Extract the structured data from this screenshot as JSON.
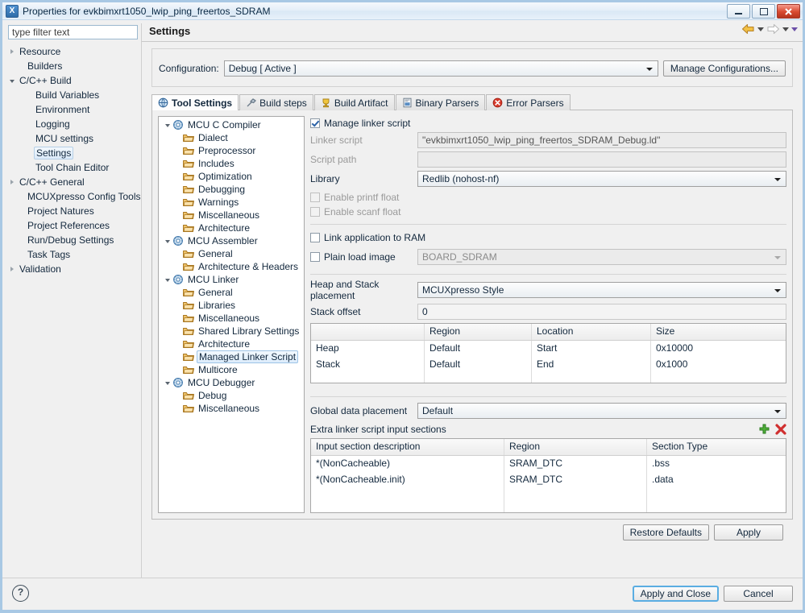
{
  "window": {
    "title": "Properties for evkbimxrt1050_lwip_ping_freertos_SDRAM",
    "app_icon": "X",
    "minimize_label": "Minimize",
    "maximize_label": "Maximize",
    "close_label": "Close"
  },
  "filter": {
    "placeholder": "type filter text",
    "value": ""
  },
  "sidebar": {
    "items": [
      {
        "label": "Resource",
        "indent": 0,
        "twisty": "collapsed",
        "selected": false
      },
      {
        "label": "Builders",
        "indent": 1,
        "twisty": "none",
        "selected": false
      },
      {
        "label": "C/C++ Build",
        "indent": 0,
        "twisty": "expanded",
        "selected": false
      },
      {
        "label": "Build Variables",
        "indent": 2,
        "twisty": "none",
        "selected": false
      },
      {
        "label": "Environment",
        "indent": 2,
        "twisty": "none",
        "selected": false
      },
      {
        "label": "Logging",
        "indent": 2,
        "twisty": "none",
        "selected": false
      },
      {
        "label": "MCU settings",
        "indent": 2,
        "twisty": "none",
        "selected": false
      },
      {
        "label": "Settings",
        "indent": 2,
        "twisty": "none",
        "selected": true
      },
      {
        "label": "Tool Chain Editor",
        "indent": 2,
        "twisty": "none",
        "selected": false
      },
      {
        "label": "C/C++ General",
        "indent": 0,
        "twisty": "collapsed",
        "selected": false
      },
      {
        "label": "MCUXpresso Config Tools",
        "indent": 1,
        "twisty": "none",
        "selected": false
      },
      {
        "label": "Project Natures",
        "indent": 1,
        "twisty": "none",
        "selected": false
      },
      {
        "label": "Project References",
        "indent": 1,
        "twisty": "none",
        "selected": false
      },
      {
        "label": "Run/Debug Settings",
        "indent": 1,
        "twisty": "none",
        "selected": false
      },
      {
        "label": "Task Tags",
        "indent": 1,
        "twisty": "none",
        "selected": false
      },
      {
        "label": "Validation",
        "indent": 0,
        "twisty": "collapsed",
        "selected": false
      }
    ]
  },
  "page": {
    "title": "Settings",
    "nav": {
      "back_icon": "back-arrow-icon",
      "back_menu_icon": "chevron-down-icon",
      "forward_icon": "forward-arrow-icon",
      "forward_menu_icon": "chevron-down-icon",
      "view_menu_icon": "chevron-down-icon"
    }
  },
  "configuration": {
    "label": "Configuration:",
    "value": "Debug  [ Active ]",
    "manage_label": "Manage Configurations..."
  },
  "tabs": [
    {
      "label": "Tool Settings",
      "icon": "tool-settings-icon",
      "active": true
    },
    {
      "label": "Build steps",
      "icon": "build-steps-icon",
      "active": false
    },
    {
      "label": "Build Artifact",
      "icon": "build-artifact-icon",
      "active": false
    },
    {
      "label": "Binary Parsers",
      "icon": "binary-parsers-icon",
      "active": false
    },
    {
      "label": "Error Parsers",
      "icon": "error-parsers-icon",
      "active": false
    }
  ],
  "tool_tree": [
    {
      "label": "MCU C Compiler",
      "indent": 0,
      "twisty": "expanded",
      "icon": "gear",
      "selected": false
    },
    {
      "label": "Dialect",
      "indent": 1,
      "twisty": "none",
      "icon": "folder",
      "selected": false
    },
    {
      "label": "Preprocessor",
      "indent": 1,
      "twisty": "none",
      "icon": "folder",
      "selected": false
    },
    {
      "label": "Includes",
      "indent": 1,
      "twisty": "none",
      "icon": "folder",
      "selected": false
    },
    {
      "label": "Optimization",
      "indent": 1,
      "twisty": "none",
      "icon": "folder",
      "selected": false
    },
    {
      "label": "Debugging",
      "indent": 1,
      "twisty": "none",
      "icon": "folder",
      "selected": false
    },
    {
      "label": "Warnings",
      "indent": 1,
      "twisty": "none",
      "icon": "folder",
      "selected": false
    },
    {
      "label": "Miscellaneous",
      "indent": 1,
      "twisty": "none",
      "icon": "folder",
      "selected": false
    },
    {
      "label": "Architecture",
      "indent": 1,
      "twisty": "none",
      "icon": "folder",
      "selected": false
    },
    {
      "label": "MCU Assembler",
      "indent": 0,
      "twisty": "expanded",
      "icon": "gear",
      "selected": false
    },
    {
      "label": "General",
      "indent": 1,
      "twisty": "none",
      "icon": "folder",
      "selected": false
    },
    {
      "label": "Architecture & Headers",
      "indent": 1,
      "twisty": "none",
      "icon": "folder",
      "selected": false
    },
    {
      "label": "MCU Linker",
      "indent": 0,
      "twisty": "expanded",
      "icon": "gear",
      "selected": false
    },
    {
      "label": "General",
      "indent": 1,
      "twisty": "none",
      "icon": "folder",
      "selected": false
    },
    {
      "label": "Libraries",
      "indent": 1,
      "twisty": "none",
      "icon": "folder",
      "selected": false
    },
    {
      "label": "Miscellaneous",
      "indent": 1,
      "twisty": "none",
      "icon": "folder",
      "selected": false
    },
    {
      "label": "Shared Library Settings",
      "indent": 1,
      "twisty": "none",
      "icon": "folder",
      "selected": false
    },
    {
      "label": "Architecture",
      "indent": 1,
      "twisty": "none",
      "icon": "folder",
      "selected": false
    },
    {
      "label": "Managed Linker Script",
      "indent": 1,
      "twisty": "none",
      "icon": "folder",
      "selected": true
    },
    {
      "label": "Multicore",
      "indent": 1,
      "twisty": "none",
      "icon": "folder",
      "selected": false
    },
    {
      "label": "MCU Debugger",
      "indent": 0,
      "twisty": "expanded",
      "icon": "gear",
      "selected": false
    },
    {
      "label": "Debug",
      "indent": 1,
      "twisty": "none",
      "icon": "folder",
      "selected": false
    },
    {
      "label": "Miscellaneous",
      "indent": 1,
      "twisty": "none",
      "icon": "folder",
      "selected": false
    }
  ],
  "settings": {
    "manage_linker_script": {
      "label": "Manage linker script",
      "checked": true,
      "enabled": true
    },
    "linker_script": {
      "label": "Linker script",
      "value": "\"evkbimxrt1050_lwip_ping_freertos_SDRAM_Debug.ld\"",
      "enabled": false
    },
    "script_path": {
      "label": "Script path",
      "value": "",
      "enabled": false
    },
    "library": {
      "label": "Library",
      "value": "Redlib (nohost-nf)"
    },
    "enable_printf_float": {
      "label": "Enable printf float",
      "checked": false,
      "enabled": false
    },
    "enable_scanf_float": {
      "label": "Enable scanf float",
      "checked": false,
      "enabled": false
    },
    "link_application_to_ram": {
      "label": "Link application to RAM",
      "checked": false,
      "enabled": true
    },
    "plain_load_image": {
      "label": "Plain load image",
      "checked": false,
      "enabled": true,
      "value": "BOARD_SDRAM"
    },
    "heap_and_stack_placement": {
      "label": "Heap and Stack placement",
      "value": "MCUXpresso Style"
    },
    "stack_offset": {
      "label": "Stack offset",
      "value": "0"
    },
    "global_data_placement": {
      "label": "Global data placement",
      "value": "Default"
    }
  },
  "heap_stack_table": {
    "columns": [
      "",
      "Region",
      "Location",
      "Size"
    ],
    "rows": [
      [
        "Heap",
        "Default",
        "Start",
        "0x10000"
      ],
      [
        "Stack",
        "Default",
        "End",
        "0x1000"
      ],
      [
        "",
        "",
        "",
        ""
      ]
    ]
  },
  "extra_sections": {
    "title": "Extra linker script input sections",
    "add_icon": "plus-icon",
    "remove_icon": "delete-x-icon",
    "columns": [
      "Input section description",
      "Region",
      "Section Type"
    ],
    "rows": [
      [
        "*(NonCacheable)",
        "SRAM_DTC",
        ".bss"
      ],
      [
        "*(NonCacheable.init)",
        "SRAM_DTC",
        ".data"
      ],
      [
        "",
        "",
        ""
      ],
      [
        "",
        "",
        ""
      ]
    ]
  },
  "footer": {
    "restore_defaults": "Restore Defaults",
    "apply": "Apply",
    "help_icon": "?",
    "apply_and_close": "Apply and Close",
    "cancel": "Cancel"
  },
  "colors": {
    "frame": "#a8c8e4",
    "panel_bg": "#f0f0f0",
    "selection_border": "#9dc4e6",
    "default_button_border": "#5aade2",
    "add_icon": "#3f9a2e",
    "remove_icon": "#cc2222",
    "nav_back": "#e8a93a",
    "close_button": "#d8492f"
  }
}
